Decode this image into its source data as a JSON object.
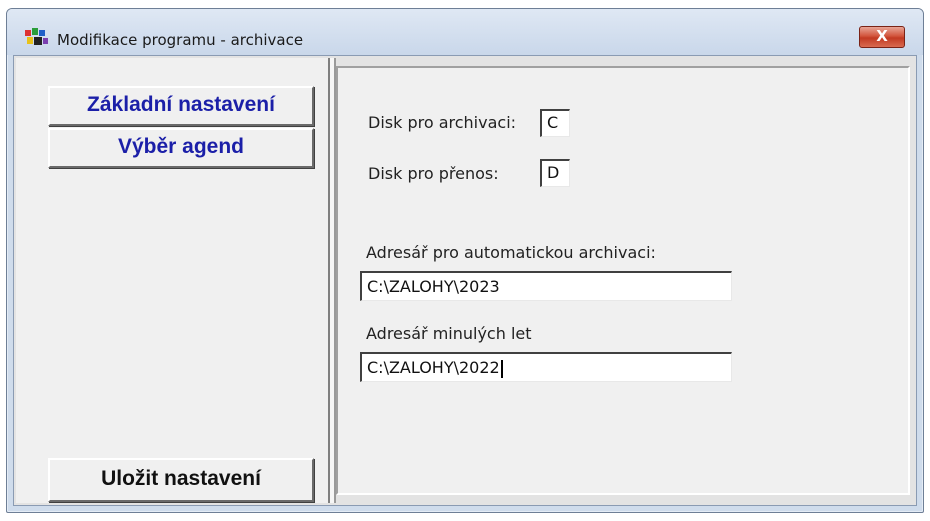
{
  "window": {
    "title": "Modifikace programu - archivace",
    "close_label": "X"
  },
  "left_panel": {
    "buttons": [
      {
        "label": "Základní nastavení"
      },
      {
        "label": "Výběr agend"
      }
    ],
    "save_button": "Uložit nastavení"
  },
  "settings": {
    "archive_disk_label": "Disk pro archivaci:",
    "archive_disk_value": "C",
    "transfer_disk_label": "Disk pro přenos:",
    "transfer_disk_value": "D",
    "auto_archive_dir_label": "Adresář pro automatickou archivaci:",
    "auto_archive_dir_value": "C:\\ZALOHY\\2023",
    "past_years_dir_label": "Adresář minulých let",
    "past_years_dir_value": "C:\\ZALOHY\\2022"
  },
  "colors": {
    "button_text_blue": "#1b1fa8",
    "close_button_red": "#c23a22"
  },
  "icons": {
    "app": "multicolor-window-icon",
    "close": "close-icon"
  }
}
